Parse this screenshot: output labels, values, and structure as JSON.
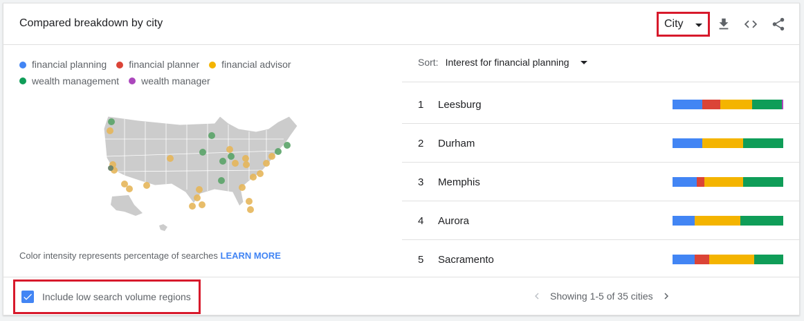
{
  "header": {
    "title": "Compared breakdown by city",
    "region_select": "City",
    "icons": [
      "download-icon",
      "embed-code-icon",
      "share-icon"
    ]
  },
  "legend": [
    {
      "label": "financial planning",
      "color": "#4285f4"
    },
    {
      "label": "financial planner",
      "color": "#db4437"
    },
    {
      "label": "financial advisor",
      "color": "#f4b400"
    },
    {
      "label": "wealth management",
      "color": "#0f9d58"
    },
    {
      "label": "wealth manager",
      "color": "#ab47bc"
    }
  ],
  "map_note": {
    "text": "Color intensity represents percentage of searches ",
    "link": "LEARN MORE"
  },
  "sort": {
    "label": "Sort:",
    "value": "Interest for financial planning"
  },
  "rows": [
    {
      "rank": "1",
      "city": "Leesburg",
      "shares": [
        27,
        16,
        29,
        27,
        1
      ]
    },
    {
      "rank": "2",
      "city": "Durham",
      "shares": [
        27,
        0,
        37,
        36,
        0
      ]
    },
    {
      "rank": "3",
      "city": "Memphis",
      "shares": [
        22,
        7,
        35,
        36,
        0
      ]
    },
    {
      "rank": "4",
      "city": "Aurora",
      "shares": [
        20,
        0,
        41,
        39,
        0
      ]
    },
    {
      "rank": "5",
      "city": "Sacramento",
      "shares": [
        20,
        13,
        41,
        26,
        0
      ]
    }
  ],
  "footer": {
    "checkbox_label": "Include low search volume regions",
    "checked": true,
    "pagination": "Showing 1-5 of 35 cities"
  }
}
